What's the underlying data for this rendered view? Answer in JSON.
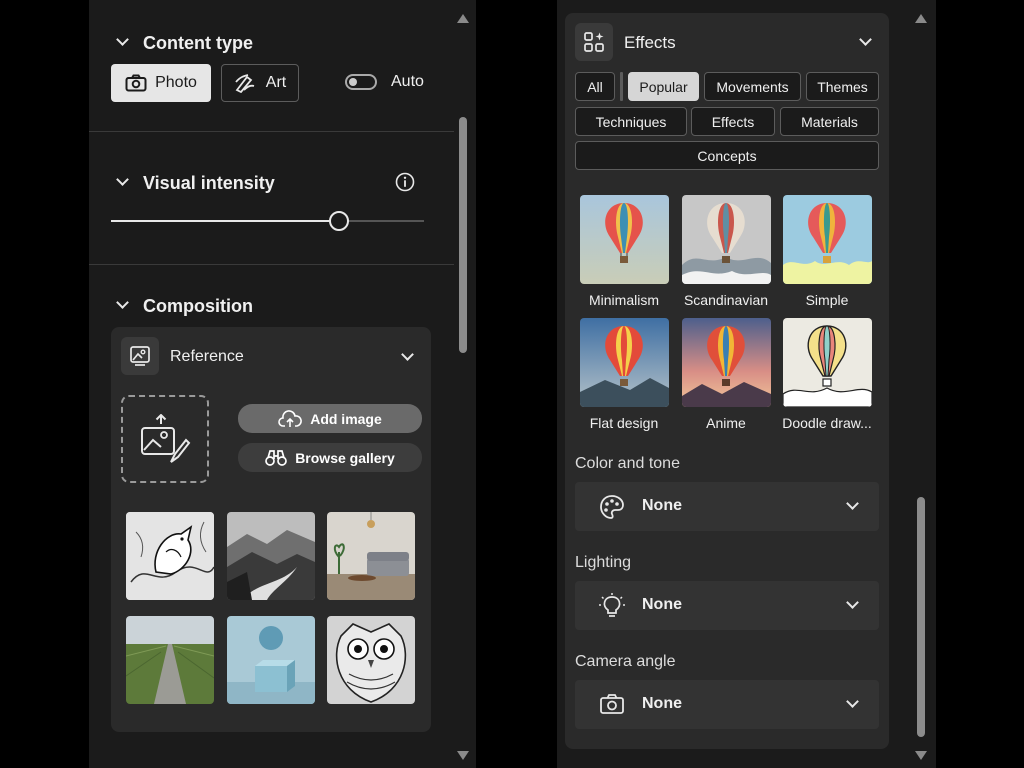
{
  "left_panel": {
    "content_type": {
      "title": "Content type",
      "photo_label": "Photo",
      "art_label": "Art",
      "auto_label": "Auto",
      "selected": "Photo"
    },
    "visual_intensity": {
      "title": "Visual intensity",
      "slider_fraction": 0.73
    },
    "composition": {
      "title": "Composition",
      "reference_label": "Reference",
      "add_image_label": "Add image",
      "browse_gallery_label": "Browse gallery",
      "gallery_icons": [
        "bird-sketch-image",
        "misty-river-image",
        "living-room-image",
        "country-road-image",
        "sphere-cube-image",
        "owl-sketch-image"
      ]
    }
  },
  "right_panel": {
    "effects": {
      "title": "Effects",
      "filters": [
        "All",
        "Popular",
        "Movements",
        "Themes",
        "Techniques",
        "Effects",
        "Materials",
        "Concepts"
      ],
      "selected_filter": "Popular",
      "styles": [
        "Minimalism",
        "Scandinavian",
        "Simple",
        "Flat design",
        "Anime",
        "Doodle draw..."
      ]
    },
    "color_and_tone": {
      "label": "Color and tone",
      "value": "None"
    },
    "lighting": {
      "label": "Lighting",
      "value": "None"
    },
    "camera_angle": {
      "label": "Camera angle",
      "value": "None"
    }
  },
  "colors": {
    "panel_bg": "#1b1b1b",
    "card_bg": "#2a2a2a",
    "selected_button": "#e6e6e6",
    "accent_text": "#f0f0f0"
  }
}
